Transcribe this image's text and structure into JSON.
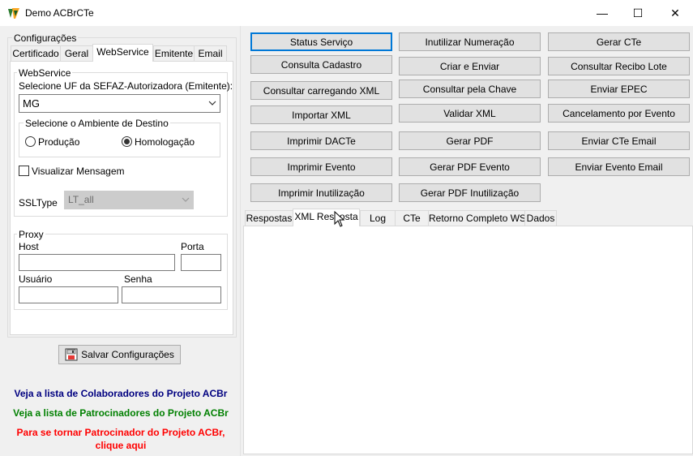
{
  "window": {
    "title": "Demo ACBrCTe",
    "app_icon": "acbr-logo-icon",
    "controls": {
      "minimize": "—",
      "maximize": "☐",
      "close": "✕"
    }
  },
  "config": {
    "group_label": "Configurações",
    "tabs": [
      {
        "label": "Certificado"
      },
      {
        "label": "Geral"
      },
      {
        "label": "WebService",
        "active": true
      },
      {
        "label": "Emitente"
      },
      {
        "label": "Email"
      }
    ],
    "webservice": {
      "group_label": "WebService",
      "uf_label": "Selecione UF da SEFAZ-Autorizadora (Emitente):",
      "uf_value": "MG",
      "ambiente": {
        "group_label": "Selecione o Ambiente de Destino",
        "producao_label": "Produção",
        "homologacao_label": "Homologação",
        "selected": "Homologação"
      },
      "visualizar_label": "Visualizar Mensagem",
      "visualizar_checked": false,
      "ssltype_label": "SSLType",
      "ssltype_value": "LT_all"
    },
    "proxy": {
      "group_label": "Proxy",
      "host_label": "Host",
      "host_value": "",
      "porta_label": "Porta",
      "porta_value": "",
      "usuario_label": "Usuário",
      "usuario_value": "",
      "senha_label": "Senha",
      "senha_value": ""
    },
    "save_button": "Salvar Configurações"
  },
  "links": {
    "colaboradores": "Veja a lista de Colaboradores do Projeto ACBr",
    "patrocinadores": "Veja a lista de Patrocinadores do Projeto ACBr",
    "tornar_line1": "Para se tornar Patrocinador do Projeto ACBr,",
    "tornar_line2": "clique aqui",
    "colors": {
      "colaboradores": "#000080",
      "patrocinadores": "#008000",
      "tornar": "#ff0000"
    }
  },
  "actions": {
    "col1": [
      "Status Serviço",
      "Consulta Cadastro",
      "Consultar carregando XML",
      "Importar XML",
      "Imprimir DACTe",
      "Imprimir Evento",
      "Imprimir Inutilização"
    ],
    "col2": [
      "Inutilizar Numeração",
      "Criar e Enviar",
      "Consultar pela Chave",
      "Validar XML",
      "Gerar PDF",
      "Gerar PDF Evento",
      "Gerar PDF Inutilização"
    ],
    "col3": [
      "Gerar CTe",
      "Consultar Recibo Lote",
      "Enviar EPEC",
      "Cancelamento por Evento",
      "Enviar CTe Email",
      "Enviar Evento Email"
    ]
  },
  "results": {
    "tabs": [
      {
        "label": "Respostas"
      },
      {
        "label": "XML Resposta",
        "active": true
      },
      {
        "label": "Log"
      },
      {
        "label": "CTe"
      },
      {
        "label": "Retorno Completo WS"
      },
      {
        "label": "Dados"
      }
    ]
  }
}
